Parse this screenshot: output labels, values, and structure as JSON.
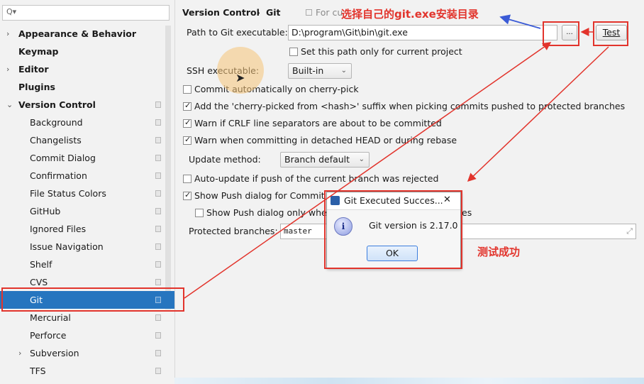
{
  "search": {
    "placeholder": "Q▾"
  },
  "sidebar": {
    "items": [
      {
        "label": "Appearance & Behavior",
        "arrow": "›"
      },
      {
        "label": "Keymap",
        "arrow": ""
      },
      {
        "label": "Editor",
        "arrow": "›"
      },
      {
        "label": "Plugins",
        "arrow": ""
      },
      {
        "label": "Version Control",
        "arrow": "⌄"
      },
      {
        "label": "Background"
      },
      {
        "label": "Changelists"
      },
      {
        "label": "Commit Dialog"
      },
      {
        "label": "Confirmation"
      },
      {
        "label": "File Status Colors"
      },
      {
        "label": "GitHub"
      },
      {
        "label": "Ignored Files"
      },
      {
        "label": "Issue Navigation"
      },
      {
        "label": "Shelf"
      },
      {
        "label": "CVS"
      },
      {
        "label": "Git"
      },
      {
        "label": "Mercurial"
      },
      {
        "label": "Perforce"
      },
      {
        "label": "Subversion",
        "arrow": "›"
      },
      {
        "label": "TFS"
      }
    ]
  },
  "breadcrumb": {
    "part1": "Version Control",
    "sep": "›",
    "part2": "Git",
    "hint": "For cu"
  },
  "path": {
    "label": "Path to Git executable:",
    "value": "D:\\program\\Git\\bin\\git.exe",
    "browse": "...",
    "test": "Test"
  },
  "project_only": {
    "label": "Set this path only for current project"
  },
  "ssh": {
    "label": "SSH executable:",
    "value": "Built-in"
  },
  "options": {
    "commit_auto": "Commit automatically on cherry-pick",
    "suffix": "Add the 'cherry-picked from <hash>' suffix when picking commits pushed to protected branches",
    "crlf": "Warn if CRLF line separators are about to be committed",
    "detached": "Warn when committing in detached HEAD or during rebase",
    "autoupdate": "Auto-update if push of the current branch was rejected",
    "push_dialog": "Show Push dialog for Commit a",
    "push_dialog_only": "Show Push dialog only when",
    "push_dialog_only_tail": "es"
  },
  "update": {
    "label": "Update method:",
    "value": "Branch default"
  },
  "protected": {
    "label": "Protected branches:",
    "value": "master"
  },
  "dialog": {
    "title": "Git Executed Succes...",
    "message": "Git version is 2.17.0",
    "ok": "OK",
    "close": "✕"
  },
  "annotations": {
    "select_exe": "选择自己的git.exe安装目录",
    "test_ok": "测试成功"
  },
  "colors": {
    "accent": "#2675bf",
    "annotation": "#e2342c",
    "arrow_blue": "#3b5bd6"
  }
}
